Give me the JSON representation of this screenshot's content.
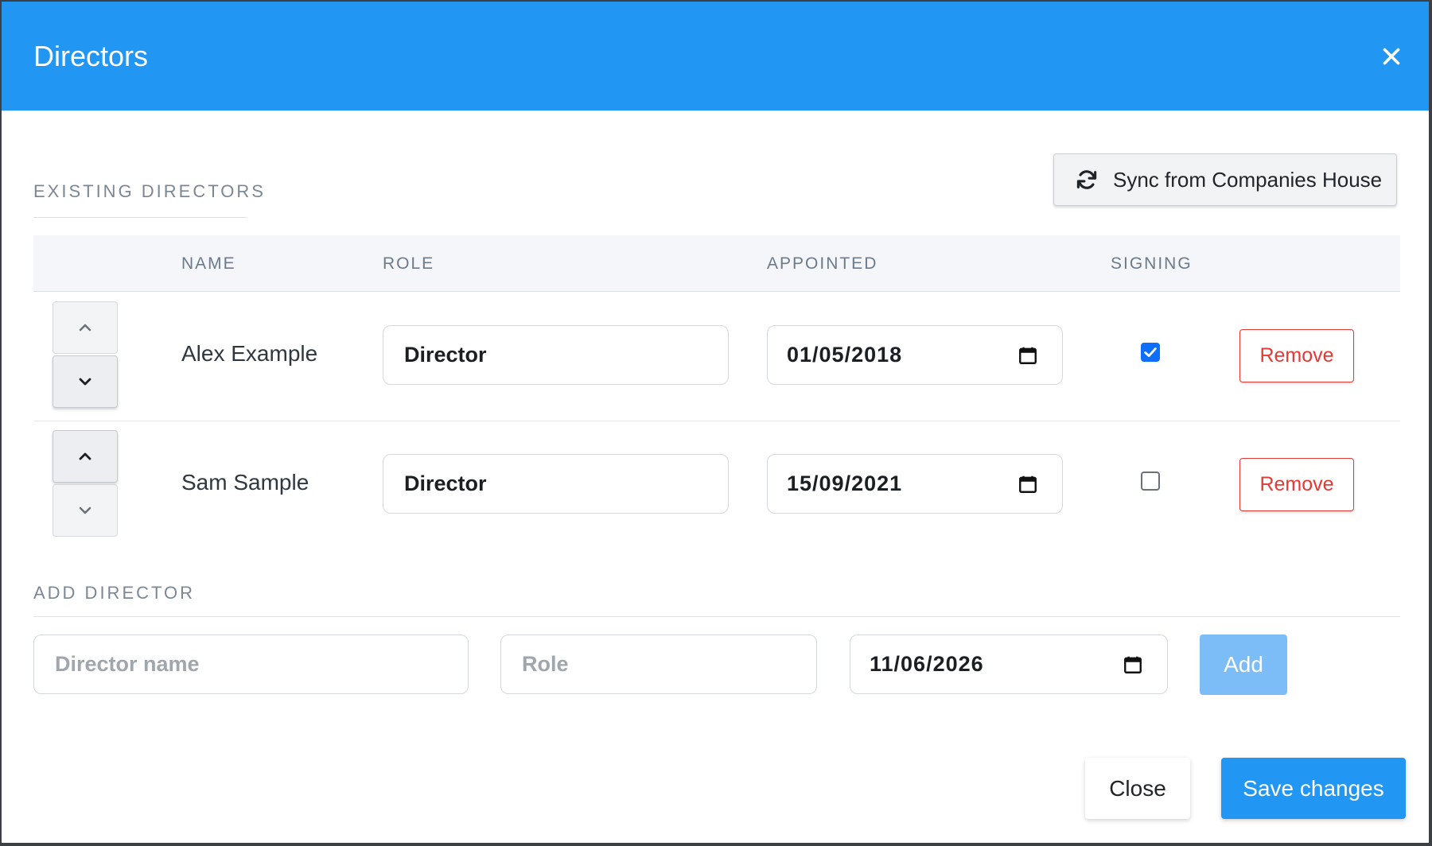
{
  "modal": {
    "title": "Directors",
    "close_icon": "close-icon"
  },
  "existing": {
    "section_label": "EXISTING DIRECTORS",
    "sync_label": "Sync from Companies House",
    "sync_icon": "sync-icon",
    "columns": [
      "NAME",
      "ROLE",
      "APPOINTED",
      "SIGNING"
    ],
    "rows": [
      {
        "name": "Alex Example",
        "role": "Director",
        "appointed": "01/05/2018",
        "signing": true,
        "remove_label": "Remove"
      },
      {
        "name": "Sam Sample",
        "role": "Director",
        "appointed": "15/09/2021",
        "signing": false,
        "remove_label": "Remove"
      }
    ]
  },
  "add": {
    "section_label": "ADD DIRECTOR",
    "name_placeholder": "Director name",
    "role_placeholder": "Role",
    "date_value": "11/06/2026",
    "add_label": "Add"
  },
  "footer": {
    "close_label": "Close",
    "save_label": "Save changes"
  },
  "colors": {
    "primary": "#2196f3",
    "danger": "#e53935",
    "checkbox": "#0d6efd"
  }
}
